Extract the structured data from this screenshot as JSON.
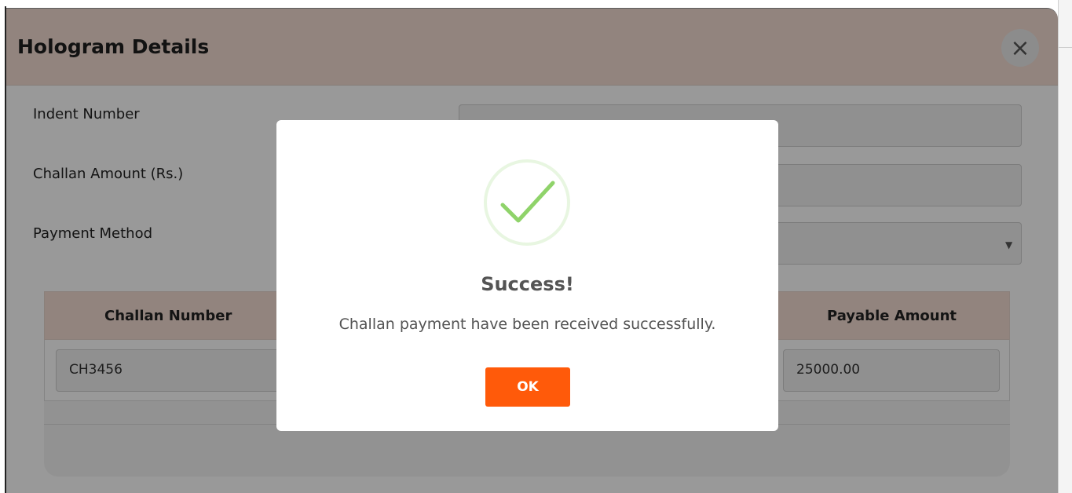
{
  "modal": {
    "title": "Hologram Details",
    "close_icon": "close-icon",
    "close_glyph": "×"
  },
  "form": {
    "indent_number_label": "Indent Number",
    "challan_amount_label": "Challan Amount (Rs.)",
    "payment_method_label": "Payment Method",
    "indent_number_value": "",
    "challan_amount_value": "",
    "payment_method_value": ""
  },
  "table": {
    "headers": [
      "Challan Number",
      "Payable Amount"
    ],
    "rows": [
      {
        "challan_number": "CH3456",
        "payable_amount": "25000.00"
      }
    ]
  },
  "dialog": {
    "icon": "success-check-icon",
    "title": "Success!",
    "message": "Challan payment have been received successfully.",
    "ok_label": "OK"
  },
  "colors": {
    "header_bg": "#f4ddd3",
    "ok_button": "#ff5a0a",
    "check_green": "#a5dc86"
  }
}
